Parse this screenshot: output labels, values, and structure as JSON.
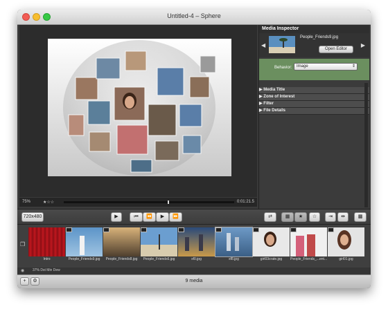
{
  "window": {
    "title": "Untitled-4 – Sphere"
  },
  "viewer": {
    "zoom": "75%",
    "rating": "★☆☆",
    "time": "0:01:21.5"
  },
  "inspector": {
    "title": "Media Inspector",
    "filename": "People_Friends9.jpg",
    "open_editor": "Open Editor",
    "behavior_label": "Behavior:",
    "behavior_value": "Image",
    "sections": [
      "Media Title",
      "Zone of Interest",
      "Filter",
      "File Details"
    ]
  },
  "toolbar": {
    "resolution": "720x480"
  },
  "strip": {
    "clips": [
      {
        "label": "Intro"
      },
      {
        "label": "People_Friends9.jpg"
      },
      {
        "label": "People_Friends8.jpg"
      },
      {
        "label": "People_Friends6.jpg"
      },
      {
        "label": "sf0.jpg"
      },
      {
        "label": "sf8.jpg"
      },
      {
        "label": "girl03crate.jpg"
      },
      {
        "label": "People_Friends_...ent..."
      },
      {
        "label": "girl01.jpg"
      }
    ]
  },
  "timeline": {
    "text": "37%   Dst Min Dew"
  },
  "status": {
    "count": "9 media"
  },
  "colors": {
    "accent_green": "#6b8f5f",
    "dark": "#3a3a3a"
  }
}
